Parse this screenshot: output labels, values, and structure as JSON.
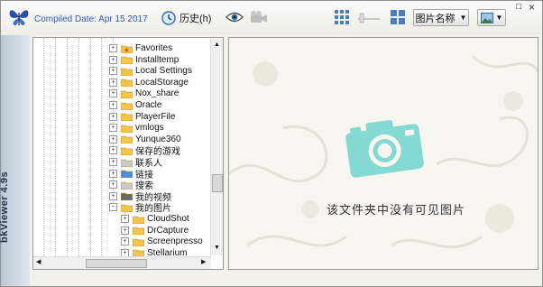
{
  "header": {
    "compiled": "Compiled Date: Apr 15 2017",
    "history_label": "历史(h)",
    "sort_label": "图片名称",
    "window_controls": [
      "□",
      "×"
    ]
  },
  "sidebar": {
    "version": "bkViewer 4.9s"
  },
  "tree": {
    "items": [
      {
        "label": "Favorites",
        "icon": "favorites-folder-icon",
        "level": 0
      },
      {
        "label": "Installtemp",
        "icon": "folder-icon",
        "level": 0
      },
      {
        "label": "Local Settings",
        "icon": "folder-icon",
        "level": 0
      },
      {
        "label": "LocalStorage",
        "icon": "folder-icon",
        "level": 0
      },
      {
        "label": "Nox_share",
        "icon": "folder-icon",
        "level": 0
      },
      {
        "label": "Oracle",
        "icon": "folder-icon",
        "level": 0
      },
      {
        "label": "PlayerFile",
        "icon": "folder-icon",
        "level": 0
      },
      {
        "label": "vmlogs",
        "icon": "folder-icon",
        "level": 0
      },
      {
        "label": "Yunque360",
        "icon": "folder-icon",
        "level": 0
      },
      {
        "label": "保存的游戏",
        "icon": "saved-games-icon",
        "level": 0
      },
      {
        "label": "联系人",
        "icon": "contacts-icon",
        "level": 0
      },
      {
        "label": "链接",
        "icon": "links-icon",
        "level": 0
      },
      {
        "label": "搜索",
        "icon": "search-folder-icon",
        "level": 0
      },
      {
        "label": "我的视频",
        "icon": "video-folder-icon",
        "level": 0
      },
      {
        "label": "我的图片",
        "icon": "pictures-folder-icon",
        "level": 0,
        "expanded": true
      },
      {
        "label": "CloudShot",
        "icon": "folder-icon",
        "level": 1
      },
      {
        "label": "DrCapture",
        "icon": "folder-icon",
        "level": 1
      },
      {
        "label": "Screenpresso",
        "icon": "folder-icon",
        "level": 1
      },
      {
        "label": "Stellarium",
        "icon": "folder-icon",
        "level": 1
      }
    ]
  },
  "preview": {
    "empty_message": "该文件夹中没有可见图片"
  },
  "colors": {
    "accent": "#2f5bb8",
    "camera": "#7fd8d2",
    "folder": "#f3c64a"
  }
}
